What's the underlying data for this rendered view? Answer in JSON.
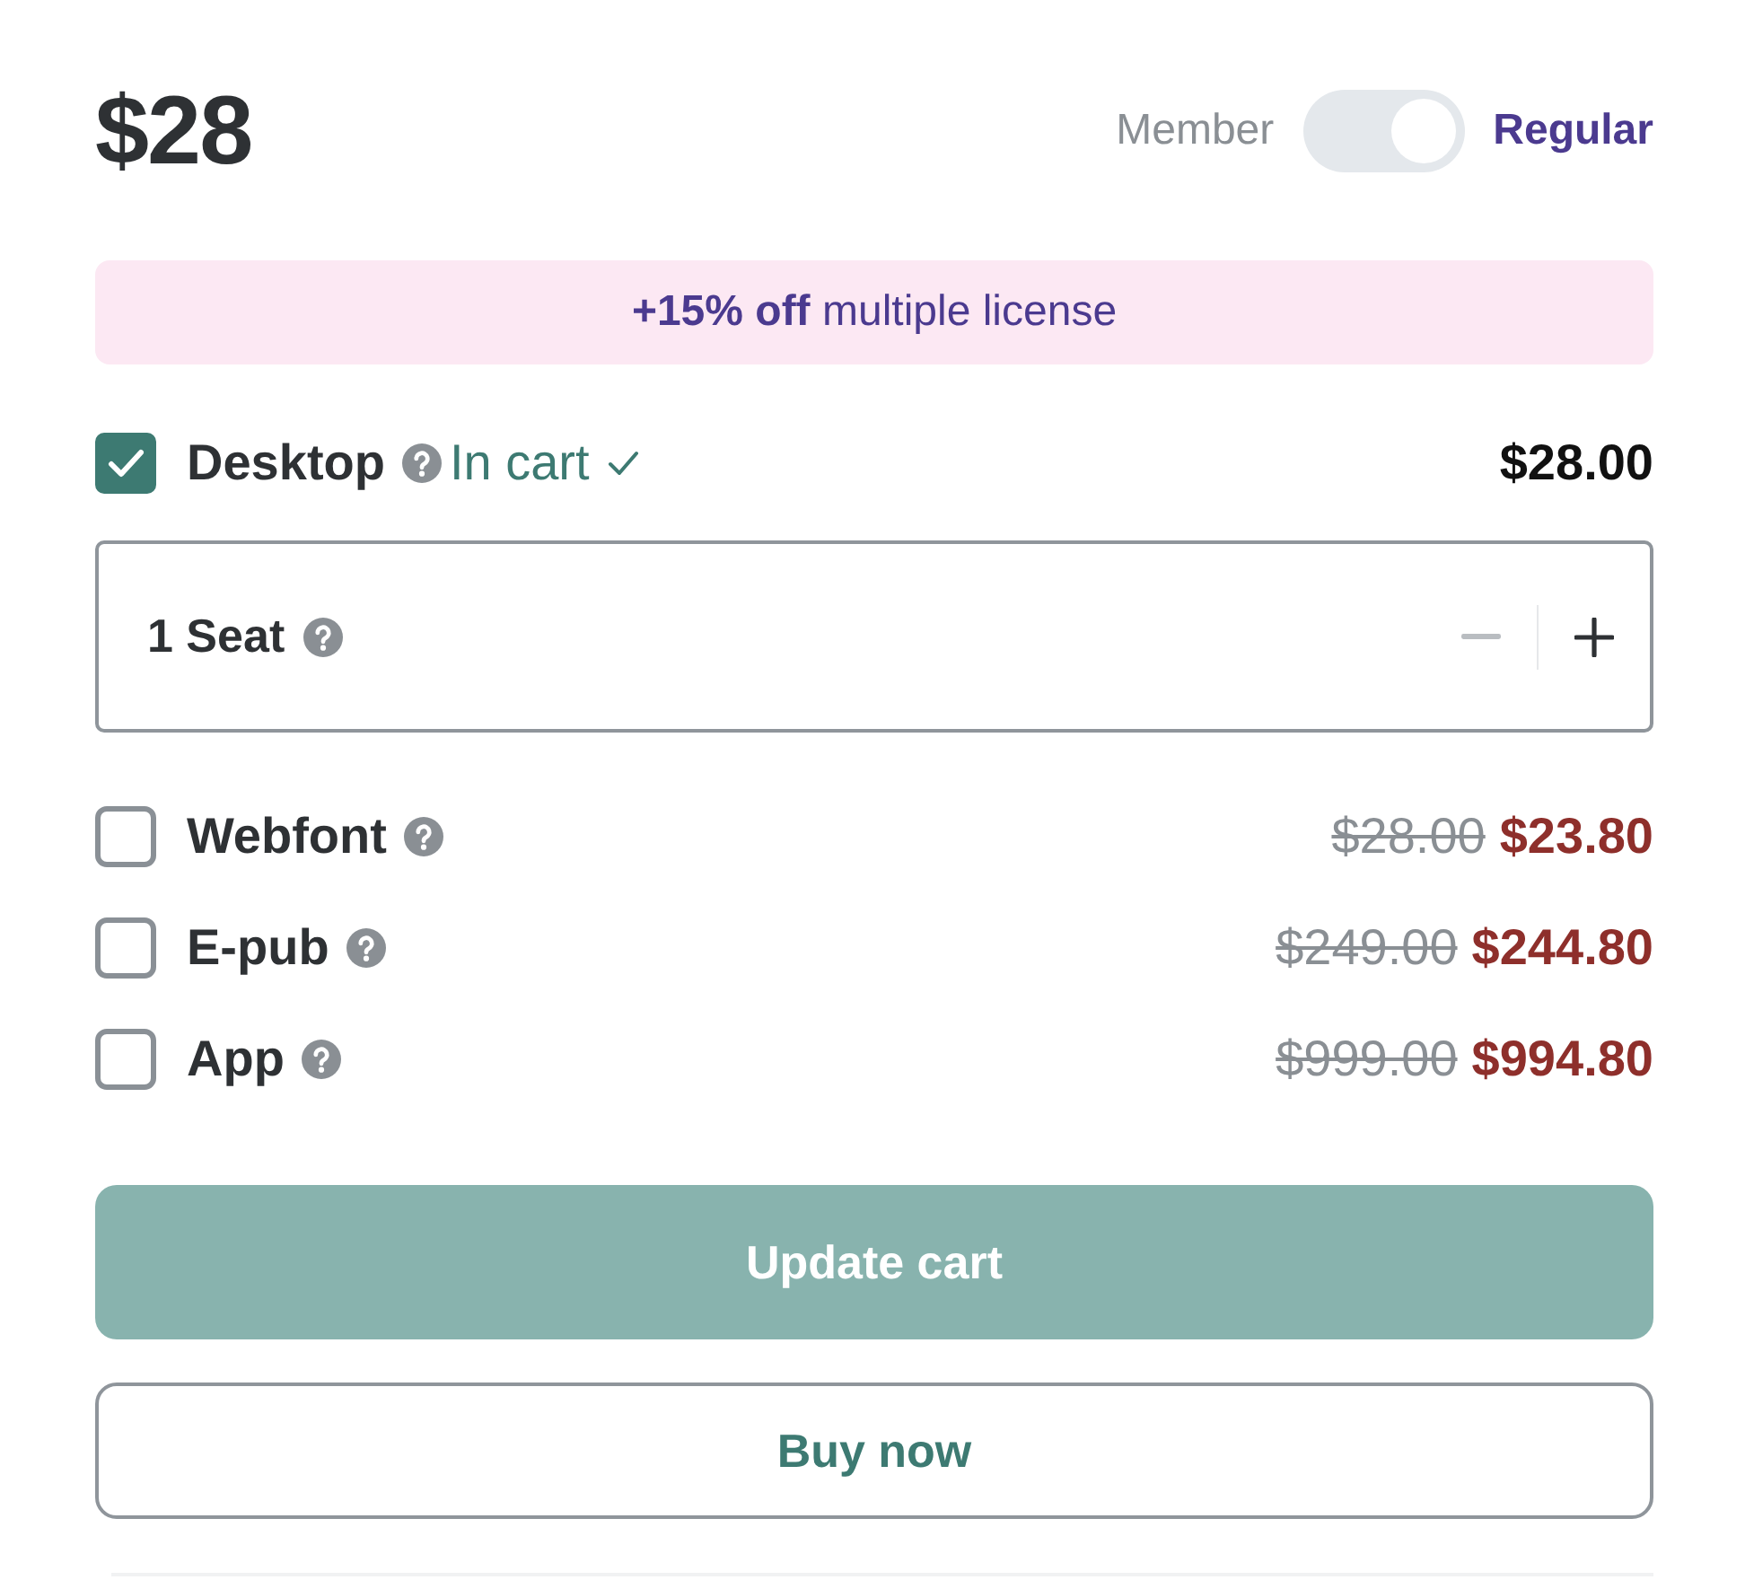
{
  "price": "$28",
  "pricing_toggle": {
    "options": [
      {
        "label": "Member",
        "selected": false
      },
      {
        "label": "Regular",
        "selected": true
      }
    ]
  },
  "discount_banner": "**+15% off** multiple license",
  "licenses": [
    {
      "name": "Desktop",
      "checked": true,
      "status": "In cart",
      "price": "$28.00",
      "seats": {
        "label": "1 Seat",
        "decrease_disabled": true
      }
    },
    {
      "name": "Webfont",
      "checked": false,
      "original_price": "$28.00",
      "price": "$23.80"
    },
    {
      "name": "E-pub",
      "checked": false,
      "original_price": "$249.00",
      "price": "$244.80"
    },
    {
      "name": "App",
      "checked": false,
      "original_price": "$999.00",
      "price": "$994.80"
    }
  ],
  "buttons": [
    {
      "label": "Update cart",
      "kind": "primary",
      "disabled": true
    },
    {
      "label": "Buy now",
      "kind": "outline",
      "disabled": false
    }
  ]
}
